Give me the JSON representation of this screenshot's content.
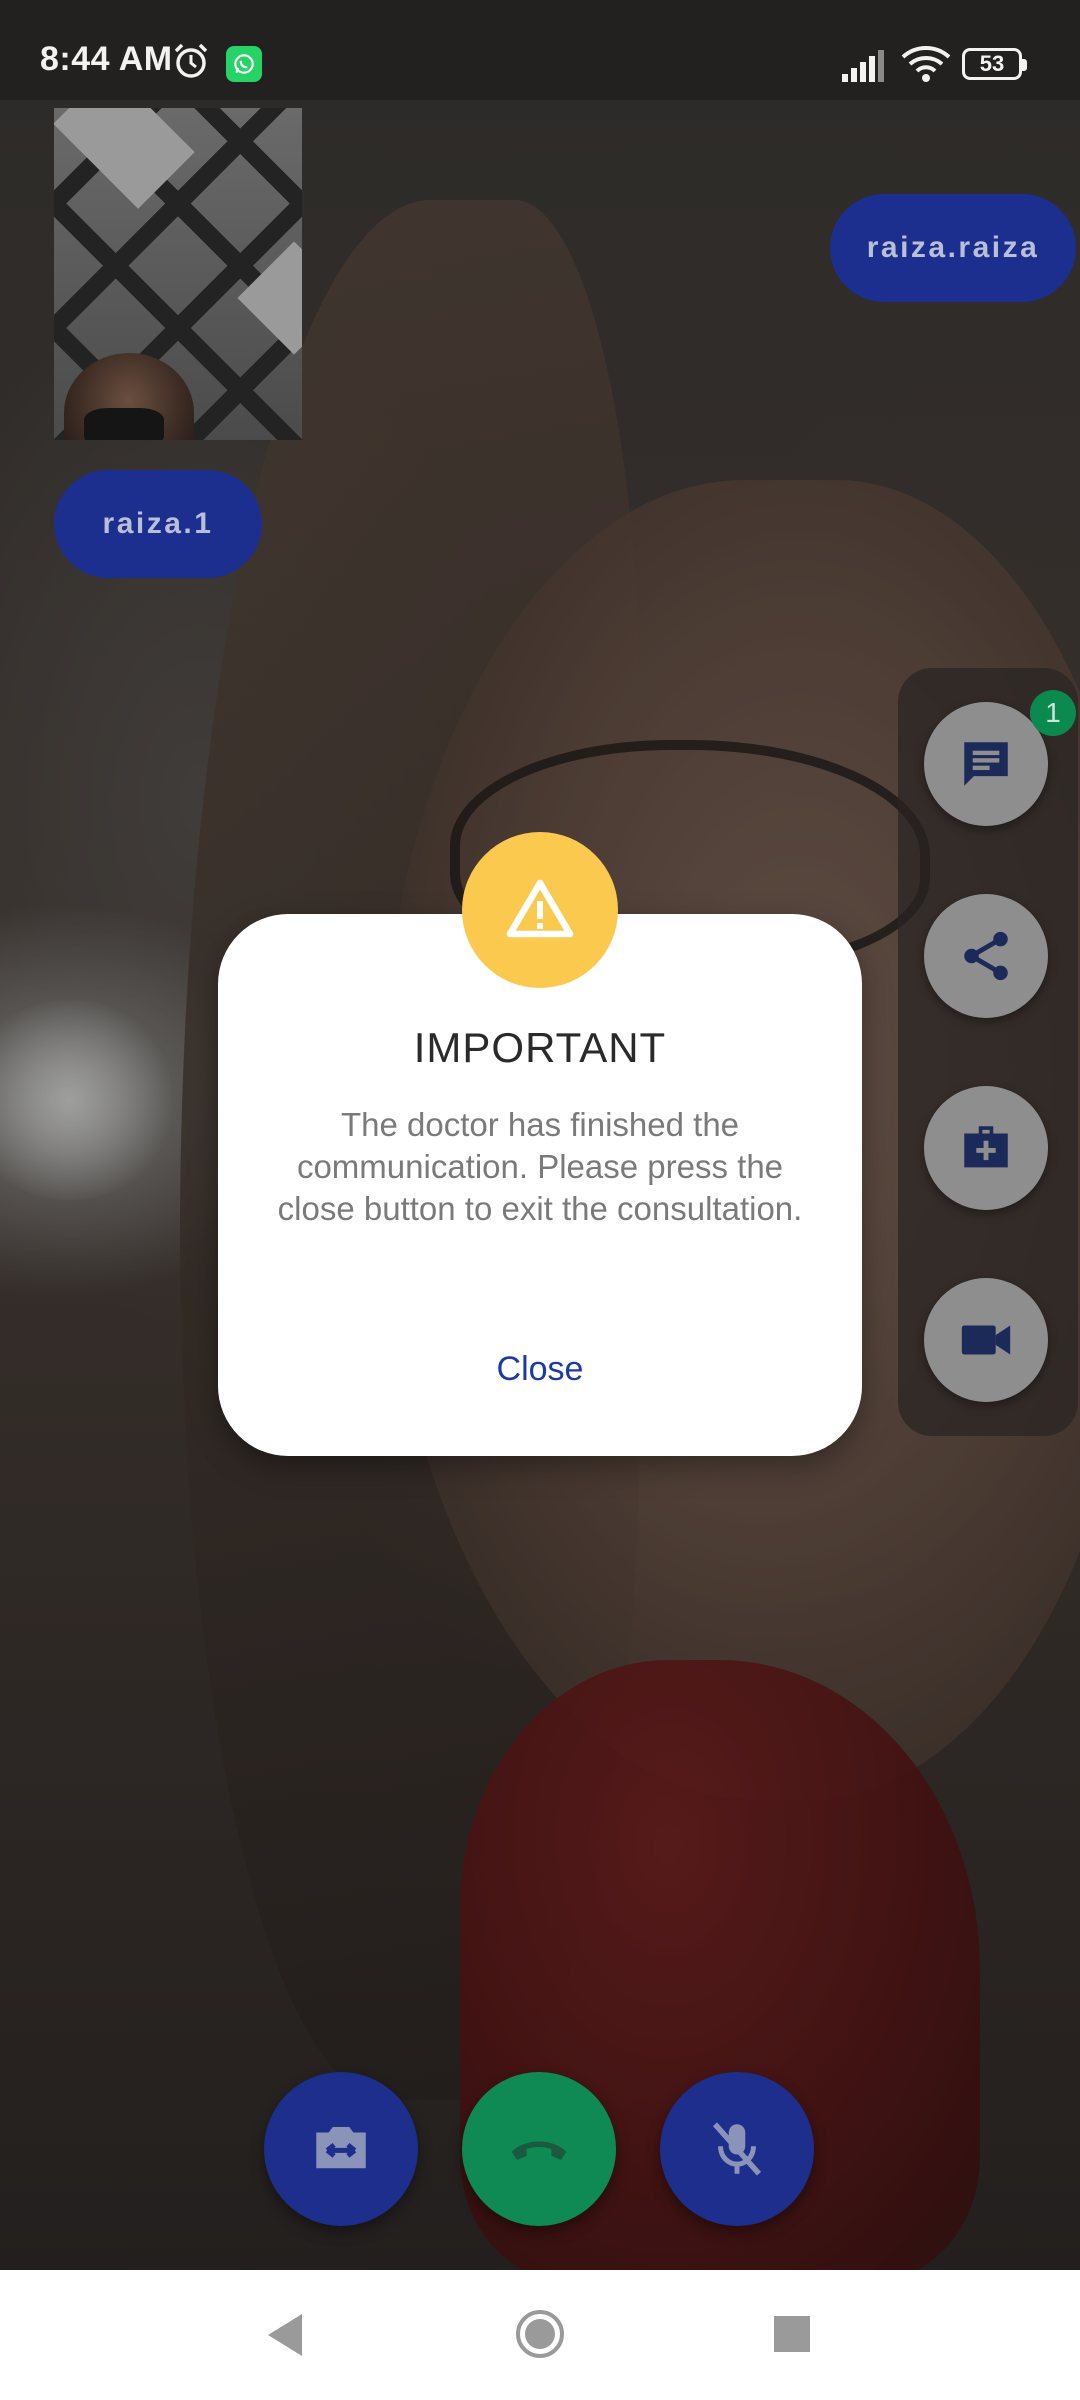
{
  "status_bar": {
    "time": "8:44 AM",
    "battery": "53",
    "icons": [
      "alarm-icon",
      "whatsapp-icon",
      "signal-icon",
      "wifi-icon",
      "battery-icon"
    ]
  },
  "participants": {
    "remote_name": "raiza.raiza",
    "local_name": "raiza.1"
  },
  "actions": {
    "chat_badge": "1",
    "buttons": [
      "chat",
      "share",
      "medical-kit",
      "video"
    ]
  },
  "dialog": {
    "title": "IMPORTANT",
    "message": "The doctor has finished the communication. Please press the close button to exit the consultation.",
    "close_label": "Close"
  },
  "call_controls": [
    "switch-camera",
    "hang-up",
    "mute-microphone"
  ],
  "colors": {
    "primary": "#1c2f8f",
    "hangup": "#0f8a55",
    "warning": "#fcc94f",
    "link": "#1b3aa8",
    "badge": "#0b8a4f"
  }
}
